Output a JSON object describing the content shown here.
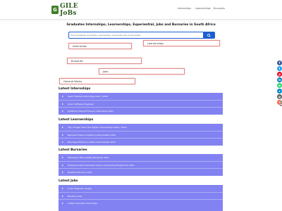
{
  "header": {
    "logo_mark": "G",
    "logo_text": "GILE JoBs",
    "nav": [
      "Internships",
      "Learnerships",
      "Bursaries"
    ]
  },
  "hero": {
    "title": "Graduates Internships, Learnerships, Experiential, Jobs and Bursaries in South Africa",
    "search_placeholder": "Search graduate internships, Learnerships, experiential, jobs and bursaries"
  },
  "categories": [
    "Internships",
    "Learnerships",
    "Bursaries",
    "Jobs",
    "General Works"
  ],
  "sections": [
    {
      "title": "Latest Internships",
      "items": [
        "Sasol Flexibel Internships 2021 / 2022",
        "Junior Software Engineer",
        "Vodafone Internal Finance Internships 2021"
      ]
    },
    {
      "title": "Latest Learnerships",
      "items": [
        "City of Cape Town Fire Fighter Learnerships 2021 / 2022",
        "Nampak Finance Solutions Learnerships 2021",
        "Bearings DHK Junior Sales Learnerships 2021"
      ]
    },
    {
      "title": "Latest Bursaries",
      "items": [
        "Polokwane Municipality Bursaries 2021",
        "Hollywood bets Graduate Career Learnership Programme 2021",
        "Nedbank Bursary 2021"
      ]
    },
    {
      "title": "Latest Jobs",
      "items": [
        "Junior Engineer Vrygrp",
        "Banking roles",
        "Calbet Guardian Internships"
      ]
    }
  ],
  "colors": {
    "accent": "#1d5fd0",
    "panel": "#8282f2",
    "logo": "#2b5d1c"
  },
  "social_icons": [
    {
      "name": "facebook-icon",
      "glyph": "f",
      "color": "#3b5998"
    },
    {
      "name": "twitter-icon",
      "glyph": "t",
      "color": "#1da1f2"
    },
    {
      "name": "pinterest-icon",
      "glyph": "p",
      "color": "#e60023"
    },
    {
      "name": "linkedin-icon",
      "glyph": "in",
      "color": "#0077b5"
    },
    {
      "name": "whatsapp-icon",
      "glyph": "w",
      "color": "#25d366"
    },
    {
      "name": "telegram-icon",
      "glyph": "➤",
      "color": "#0088cc"
    },
    {
      "name": "email-icon",
      "glyph": "@",
      "color": "#555555"
    },
    {
      "name": "share-icon",
      "glyph": "+",
      "color": "#ff6550"
    }
  ]
}
